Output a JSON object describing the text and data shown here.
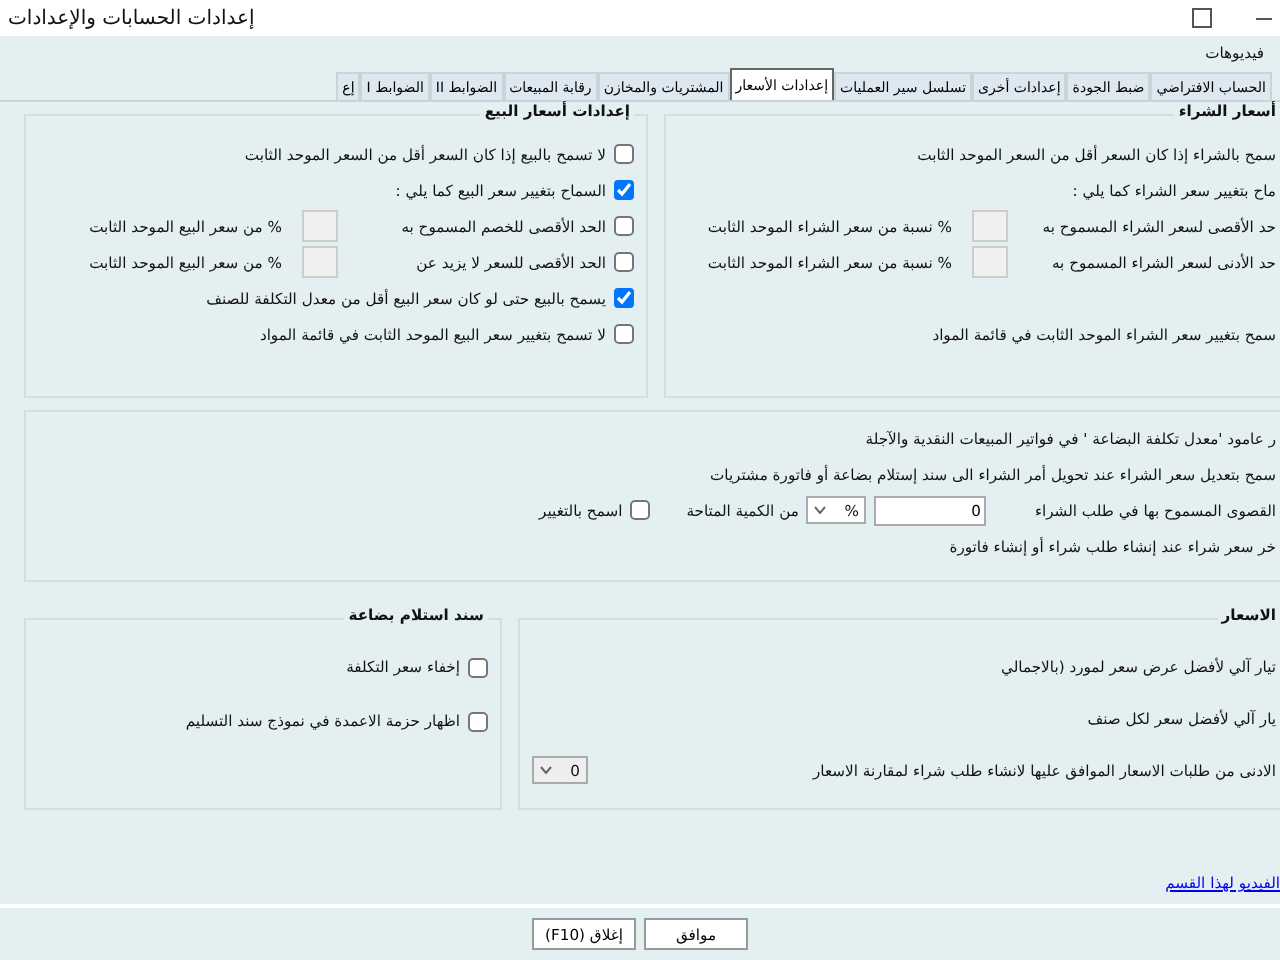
{
  "window": {
    "title": "إعدادات الحسابات والإعدادات"
  },
  "menu": [
    "فيديوهات"
  ],
  "tabs": [
    {
      "label": "الحساب الافتراضي",
      "selected": false
    },
    {
      "label": "ضبط الجودة",
      "selected": false
    },
    {
      "label": "إعدادات أخرى",
      "selected": false
    },
    {
      "label": "تسلسل سير العمليات",
      "selected": false
    },
    {
      "label": "إعدادات الأسعار",
      "selected": true
    },
    {
      "label": "المشتريات والمخازن",
      "selected": false
    },
    {
      "label": "رقابة المبيعات",
      "selected": false
    },
    {
      "label": "الضوابط II",
      "selected": false
    },
    {
      "label": "الضوابط I",
      "selected": false
    },
    {
      "label": "إع",
      "selected": false
    }
  ],
  "purchase_prices": {
    "title": "أسعار الشراء",
    "rows": [
      {
        "kind": "plain",
        "label": "سمح بالشراء إذا كان السعر أقل من السعر الموحد الثابت"
      },
      {
        "kind": "plain",
        "label": "ماح بتغيير سعر الشراء كما يلي :"
      },
      {
        "kind": "limit_plain",
        "label": "حد الأقصى لسعر الشراء المسموح به",
        "suffix": "% نسبة من سعر الشراء الموحد الثابت"
      },
      {
        "kind": "limit_plain",
        "label": "حد الأدنى لسعر الشراء المسموح به",
        "suffix": "% نسبة من سعر الشراء الموحد الثابت"
      },
      {
        "kind": "gap"
      },
      {
        "kind": "plain",
        "label": "سمح بتغيير سعر الشراء الموحد الثابت في قائمة المواد"
      }
    ]
  },
  "sale_prices": {
    "title": "إعدادات أسعار البيع",
    "rows": [
      {
        "kind": "check",
        "checked": false,
        "label": "لا تسمح بالبيع إذا كان السعر أقل من السعر الموحد الثابت"
      },
      {
        "kind": "check",
        "checked": true,
        "label": "السماح بتغيير سعر البيع كما يلي :"
      },
      {
        "kind": "limit",
        "checked": false,
        "label": "الحد الأقصى للخصم المسموح به",
        "suffix": "% من سعر البيع الموحد الثابت"
      },
      {
        "kind": "limit",
        "checked": false,
        "label": "الحد الأقصى للسعر لا يزيد عن",
        "suffix": "% من سعر البيع الموحد الثابت"
      },
      {
        "kind": "check",
        "checked": true,
        "label": "يسمح بالبيع حتى لو كان سعر البيع أقل من معدل التكلفة للصنف"
      },
      {
        "kind": "check",
        "checked": false,
        "label": "لا تسمح بتغيير سعر البيع الموحد الثابت في قائمة المواد"
      }
    ]
  },
  "general": {
    "rows": [
      {
        "kind": "plain",
        "label": "ر عامود 'معدل تكلفة البضاعة ' في فواتير المبيعات النقدية والآجلة"
      },
      {
        "kind": "plain",
        "label": "سمح بتعديل سعر الشراء عند تحويل أمر الشراء الى سند إستلام بضاعة أو فاتورة مشتريات"
      },
      {
        "kind": "quantity",
        "label": "القصوى المسموح بها في طلب الشراء",
        "value": "0",
        "unit": "%",
        "suffix": "من الكمية المتاحة",
        "allow_label": "اسمح بالتغيير",
        "allow_checked": false
      },
      {
        "kind": "plain",
        "label": "خر سعر شراء عند إنشاء طلب شراء أو إنشاء فاتورة"
      }
    ]
  },
  "quotations": {
    "title": "الاسعار",
    "rows": [
      {
        "kind": "plain",
        "label": "تيار آلي لأفضل عرض سعر لمورد (بالاجمالي"
      },
      {
        "kind": "plain",
        "label": "يار آلي لأفضل سعر لكل صنف"
      },
      {
        "kind": "select",
        "label": "الادنى من طلبات الاسعار الموافق عليها لانشاء طلب شراء لمقارنة الاسعار",
        "value": "0"
      }
    ]
  },
  "goods_receipt": {
    "title": "سند استلام بضاعة",
    "rows": [
      {
        "kind": "check",
        "checked": false,
        "label": "إخفاء سعر التكلفة"
      },
      {
        "kind": "check",
        "checked": false,
        "label": "اظهار حزمة الاعمدة في نموذج سند التسليم"
      }
    ]
  },
  "video_link": "الفيديو لهذا القسم",
  "buttons": [
    "موافق",
    "إغلاق (F10)"
  ]
}
